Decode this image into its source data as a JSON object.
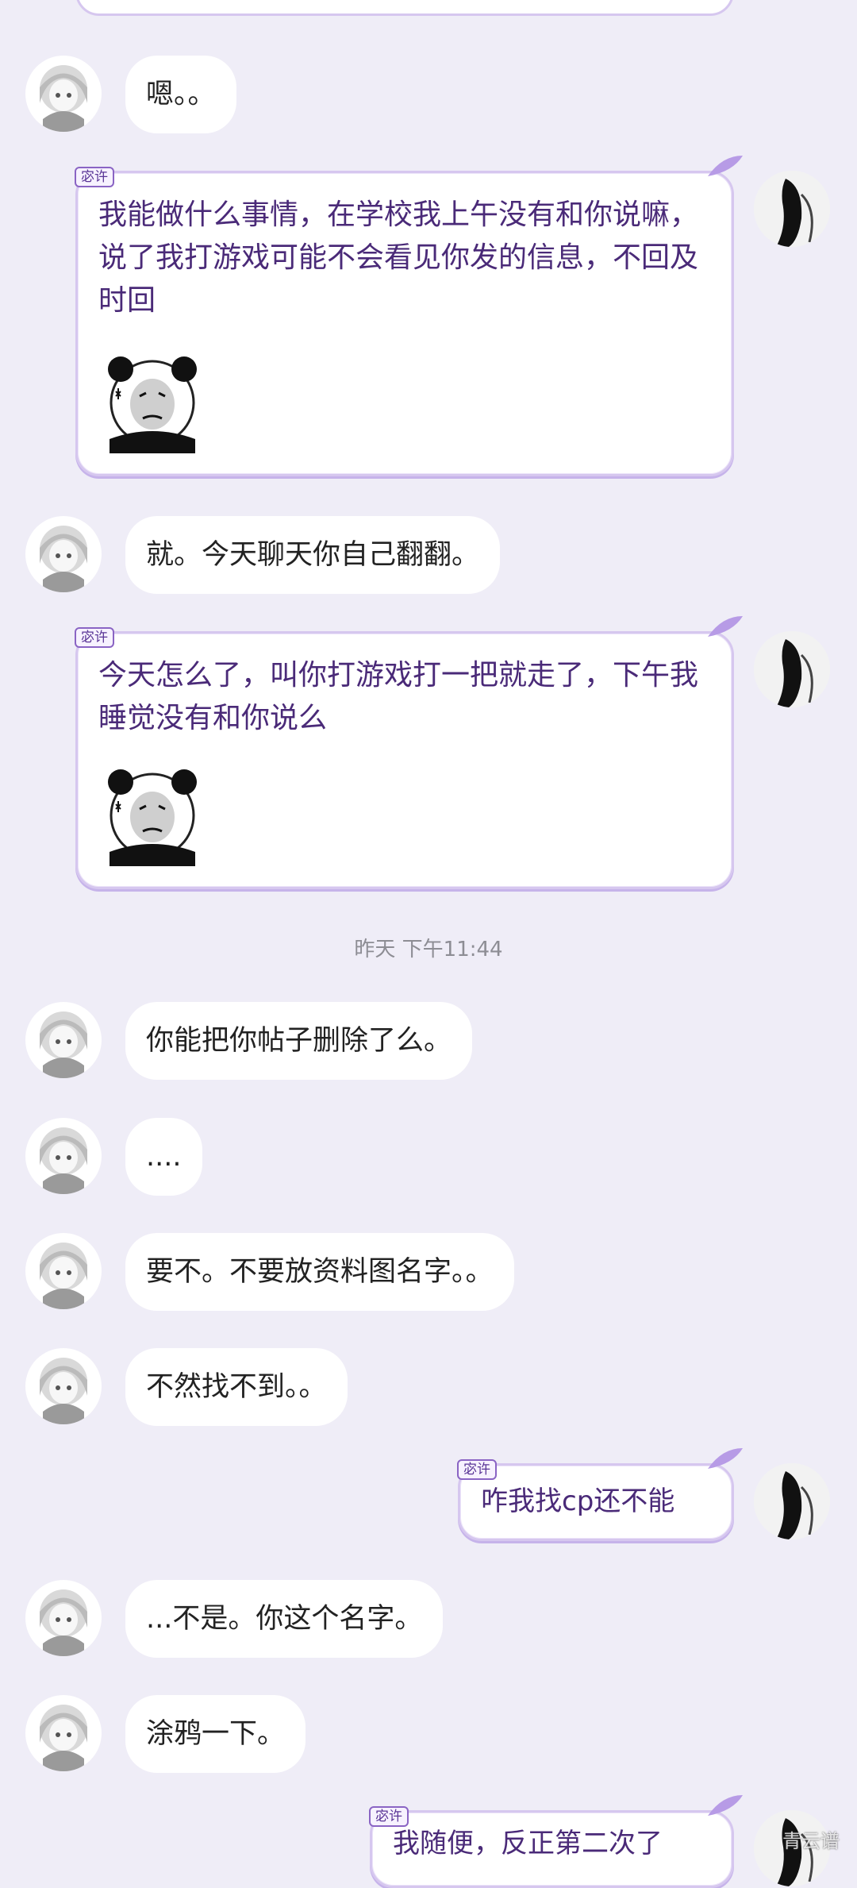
{
  "messages": {
    "m1": "嗯。。",
    "m2": "我能做什么事情，在学校我上午没有和你说嘛，说了我打游戏可能不会看见你发的信息，不回及时回",
    "m3": "就。今天聊天你自己翻翻。",
    "m4": "今天怎么了，叫你打游戏打一把就走了，下午我睡觉没有和你说么",
    "m5": "你能把你帖子删除了么。",
    "m6": "....",
    "m7": "要不。不要放资料图名字。。",
    "m8": "不然找不到。。",
    "m9": "咋我找cp还不能",
    "m10": "...不是。你这个名字。",
    "m11": "涂鸦一下。",
    "m12": "我随便，反正第二次了"
  },
  "timestamp": "昨天 下午11:44",
  "bubble_tag": "宓许",
  "watermark": "青云谱",
  "colors": {
    "background": "#efedf7",
    "accent_purple": "#4a2a78",
    "bubble_border": "#d6c7ef"
  }
}
